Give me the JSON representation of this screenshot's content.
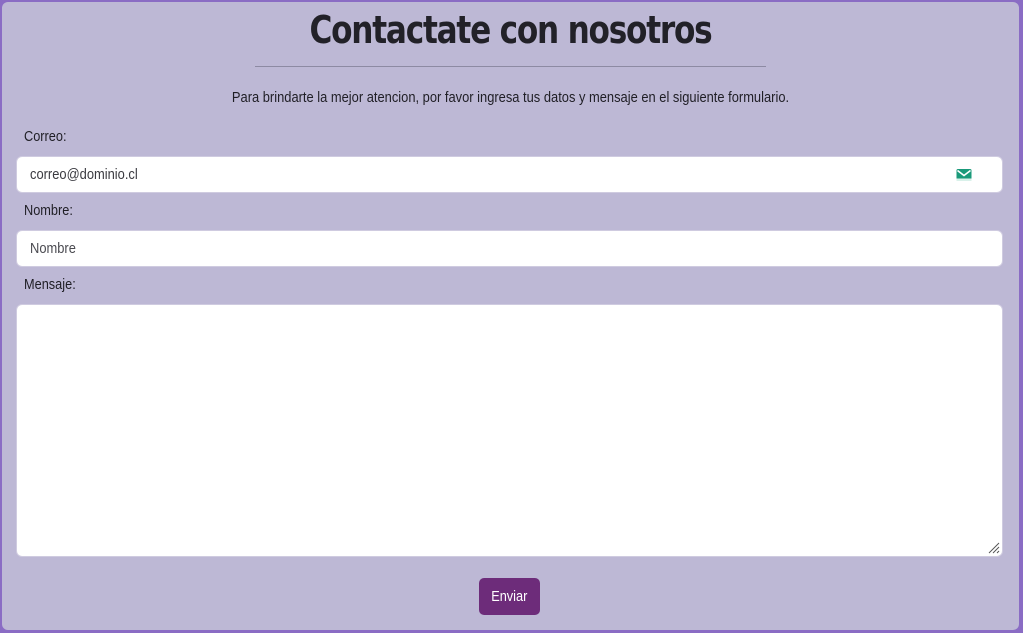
{
  "page": {
    "title": "Contactate con nosotros",
    "subtitle": "Para brindarte la mejor atencion, por favor ingresa tus datos y mensaje en el siguiente formulario."
  },
  "form": {
    "email": {
      "label": "Correo:",
      "value": "correo@dominio.cl",
      "icon": "mail-icon"
    },
    "name": {
      "label": "Nombre:",
      "placeholder": "Nombre"
    },
    "message": {
      "label": "Mensaje:",
      "value": ""
    },
    "submit_label": "Enviar"
  },
  "colors": {
    "card_background": "#bdb8d5",
    "outer_border": "#8a6cc4",
    "button": "#6d2c7a",
    "icon_accent": "#1a9a7a"
  }
}
